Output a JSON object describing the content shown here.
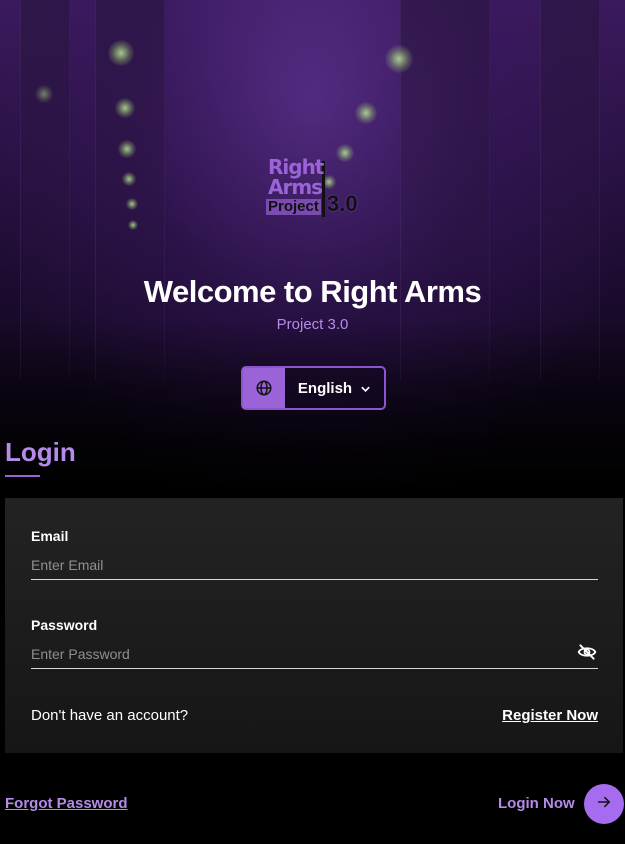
{
  "app": {
    "logo_text": [
      "Right",
      "Arms",
      "Project",
      "3.0"
    ],
    "title": "Welcome to Right Arms",
    "subtitle": "Project 3.0"
  },
  "language": {
    "selected": "English",
    "icon": "globe-icon",
    "dropdown_icon": "chevron-down-icon"
  },
  "login": {
    "heading": "Login",
    "email_label": "Email",
    "email_placeholder": "Enter Email",
    "email_value": "",
    "password_label": "Password",
    "password_placeholder": "Enter Password",
    "password_value": "",
    "visibility_icon": "eye-off-icon",
    "no_account_text": "Don't have an account?",
    "register_link": "Register Now",
    "forgot_link": "Forgot Password",
    "submit_label": "Login Now",
    "submit_icon": "arrow-right-icon"
  },
  "colors": {
    "accent": "#a56cf0",
    "accent_text": "#b58bea",
    "card_bg": "#1e1e1e",
    "page_bg": "#000000"
  }
}
